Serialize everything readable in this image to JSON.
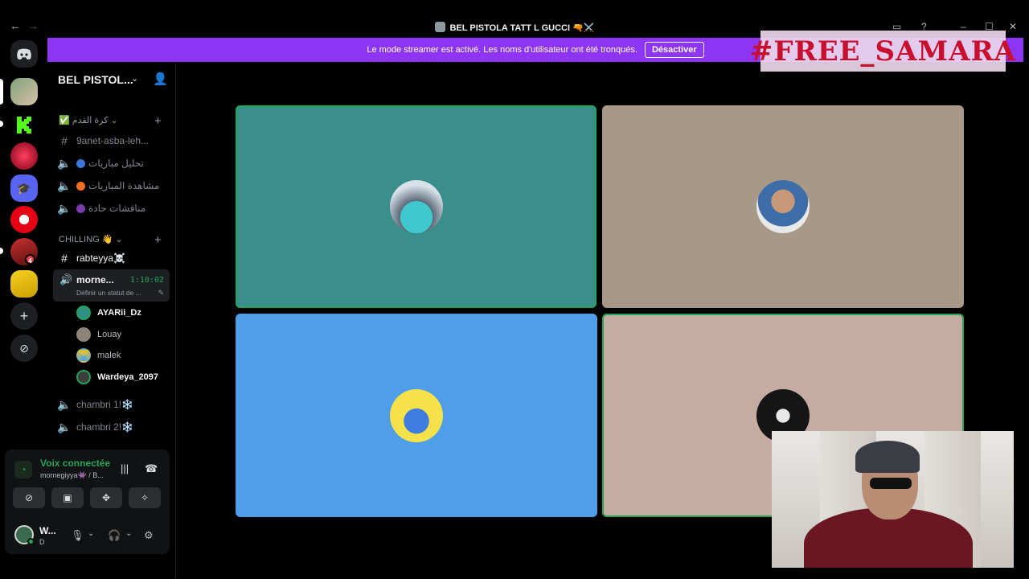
{
  "window": {
    "title": "BEL PISTOLA TATT L GUCCI 🔫⚔️",
    "back_icon": "←",
    "forward_icon": "→"
  },
  "banner": {
    "message": "Le mode streamer est activé. Les noms d'utilisateur ont été tronqués.",
    "button_label": "Désactiver"
  },
  "overlay": {
    "text": "#FREE_SAMARA"
  },
  "server_rail": {
    "mention_badge": "4"
  },
  "sidebar": {
    "server_name": "BEL PISTOL...",
    "category1": "✅ كرة القدم",
    "channels_top": [
      {
        "icon": "#",
        "label": "9anet-asba-leh..."
      },
      {
        "icon": "🔊",
        "label": "تحليل مباريات"
      },
      {
        "icon": "🔊",
        "label": "مشاهدة المباريات"
      },
      {
        "icon": "🔊",
        "label": "مناقشات حادة"
      }
    ],
    "category2": "CHILLING 👋",
    "text_channel": "rabteyya☠️",
    "active_voice": {
      "name": "morne...",
      "timer": "1:10:02",
      "status": "Définir un statut de ..."
    },
    "voice_users": [
      "AYARii_Dz",
      "Louay",
      "malek",
      "Wardeya_2097"
    ],
    "channels_bottom": [
      "chambri 1!❄️",
      "chambri 2!❄️"
    ]
  },
  "voice_panel": {
    "title": "Voix connectée",
    "subtitle": "mornegiyya👾 / B...",
    "user_name": "W...",
    "user_status": "D"
  },
  "colors": {
    "accent_purple": "#8d34f5",
    "speaking_green": "#23a55a",
    "tile1": "#3a8f8c",
    "tile2": "#a89888",
    "tile3": "#519ee8",
    "tile4": "#c6aba3"
  }
}
